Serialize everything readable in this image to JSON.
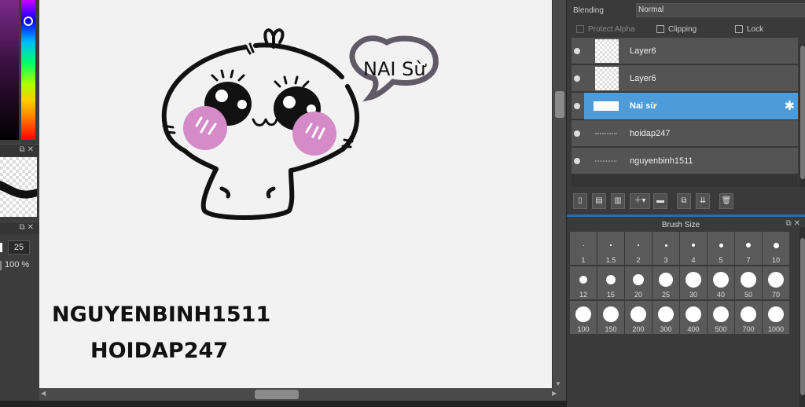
{
  "layers_panel": {
    "blending_label": "Blending",
    "blending_value": "Normal",
    "protect_alpha_label": "Protect Alpha",
    "clipping_label": "Clipping",
    "lock_label": "Lock",
    "layers": [
      {
        "name": "Layer6",
        "selected": false,
        "thumb": "checker"
      },
      {
        "name": "Layer6",
        "selected": false,
        "thumb": "checker"
      },
      {
        "name": "Nai sừ",
        "selected": true,
        "thumb": "text"
      },
      {
        "name": "hoidap247",
        "selected": false,
        "thumb": "text"
      },
      {
        "name": "nguyenbinh1511",
        "selected": false,
        "thumb": "text"
      }
    ],
    "toolbar_icons": [
      "new-layer-icon",
      "new-layer-8bit-icon",
      "new-layer-1bit-icon",
      "add-layer-dropdown-icon",
      "folder-icon",
      "duplicate-layer-icon",
      "merge-layer-icon",
      "delete-layer-icon"
    ]
  },
  "brush_size_panel": {
    "title": "Brush Size",
    "sizes": [
      "1",
      "1.5",
      "2",
      "3",
      "4",
      "5",
      "7",
      "10",
      "12",
      "15",
      "20",
      "25",
      "30",
      "40",
      "50",
      "70",
      "100",
      "150",
      "200",
      "300",
      "400",
      "500",
      "700",
      "1000"
    ]
  },
  "left_panel": {
    "brush_size_value": "25",
    "opacity_value": "100 %"
  },
  "canvas": {
    "bubble_text": "NAI Sừ",
    "watermark_1": "NGUYENBINH1511",
    "watermark_2": "HOIDAP247"
  },
  "colors": {
    "selected_layer": "#4d9bd9",
    "blush": "#d48bc7",
    "canvas_bg": "#f2f2f2",
    "bubble_outline": "#5f5a66"
  }
}
